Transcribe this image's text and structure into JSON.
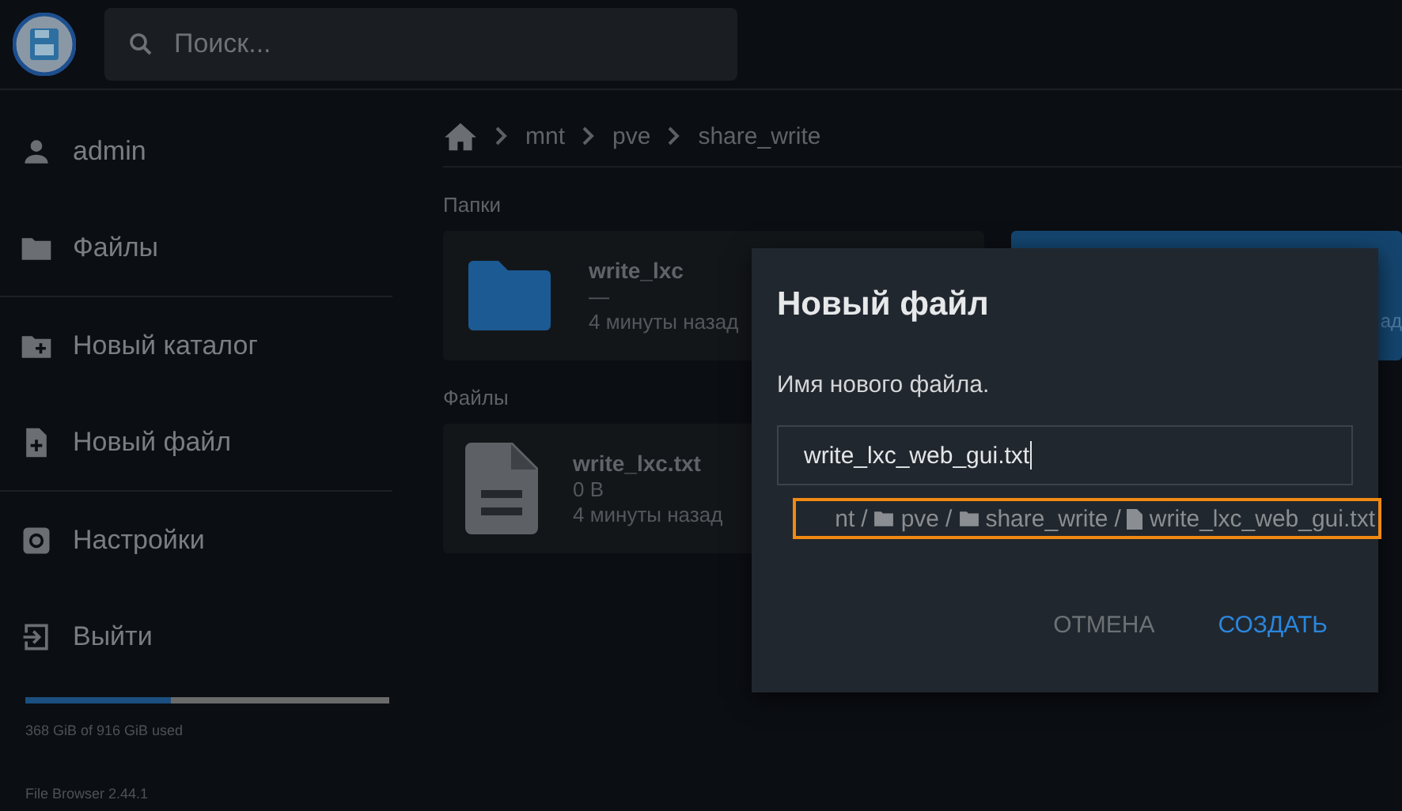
{
  "header": {
    "search": {
      "placeholder": "Поиск..."
    }
  },
  "sidebar": {
    "items": [
      {
        "kind": "user",
        "label": "admin"
      },
      {
        "kind": "folder",
        "label": "Файлы"
      },
      {
        "kind": "divider"
      },
      {
        "kind": "new-folder",
        "label": "Новый каталог"
      },
      {
        "kind": "new-file",
        "label": "Новый файл"
      },
      {
        "kind": "divider"
      },
      {
        "kind": "settings",
        "label": "Настройки"
      },
      {
        "kind": "logout",
        "label": "Выйти"
      }
    ],
    "usage": {
      "level": 0.4,
      "text": "368 GiB of 916 GiB used"
    },
    "version": "File Browser 2.44.1"
  },
  "breadcrumbs": [
    "mnt",
    "pve",
    "share_write"
  ],
  "sections": [
    {
      "title": "Папки",
      "items": [
        {
          "kind": "folder",
          "name": "write_lxc",
          "size": "—",
          "modified": "4 минуты назад",
          "selected": false
        },
        {
          "kind": "folder",
          "modified": "ад",
          "selected": true
        }
      ]
    },
    {
      "title": "Файлы",
      "items": [
        {
          "kind": "file",
          "name": "write_lxc.txt",
          "size": "0 B",
          "modified": "4 минуты назад",
          "selected": false
        }
      ]
    }
  ],
  "dialog": {
    "title": "Новый файл",
    "prompt": "Имя нового файла.",
    "value": "write_lxc_web_gui.txt",
    "path": [
      {
        "kind": "text",
        "label": "nt"
      },
      {
        "kind": "folder",
        "label": "pve"
      },
      {
        "kind": "folder",
        "label": "share_write"
      },
      {
        "kind": "file",
        "label": "write_lxc_web_gui.txt"
      }
    ],
    "separator": "/",
    "buttons": [
      {
        "kind": "cancel",
        "label": "ОТМЕНА"
      },
      {
        "kind": "primary",
        "label": "СОЗДАТЬ"
      }
    ]
  }
}
